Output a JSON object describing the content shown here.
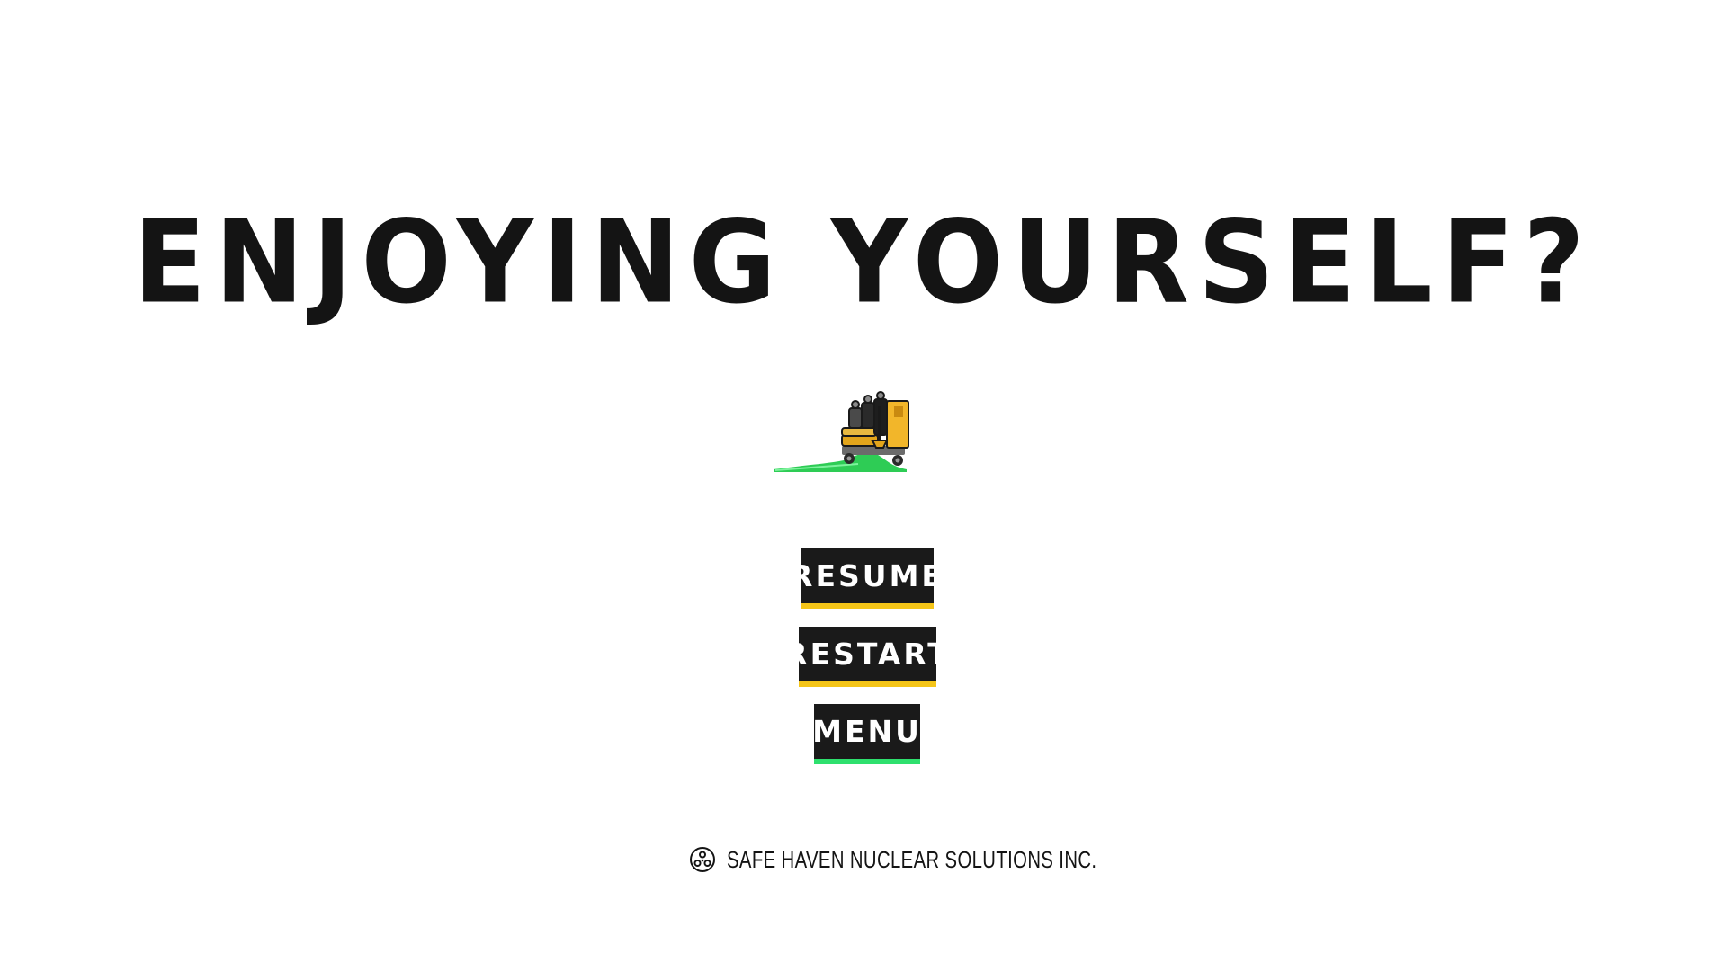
{
  "title": "ENJOYING YOURSELF?",
  "mascot": {
    "icon": "janitor-cart-icon",
    "slime_color": "#2ecc55"
  },
  "buttons": [
    {
      "id": "resume",
      "label": "RESUME",
      "accent_color": "#f5c518"
    },
    {
      "id": "restart",
      "label": "RESTART",
      "accent_color": "#f5c518"
    },
    {
      "id": "menu",
      "label": "MENU",
      "accent_color": "#2ee06e",
      "selected": true
    }
  ],
  "footer": {
    "logo_icon": "radiation-trefoil-icon",
    "company": "SAFE HAVEN NUCLEAR SOLUTIONS INC."
  },
  "colors": {
    "background": "#ffffff",
    "text": "#141414",
    "button_bg": "#1a1a1a"
  }
}
